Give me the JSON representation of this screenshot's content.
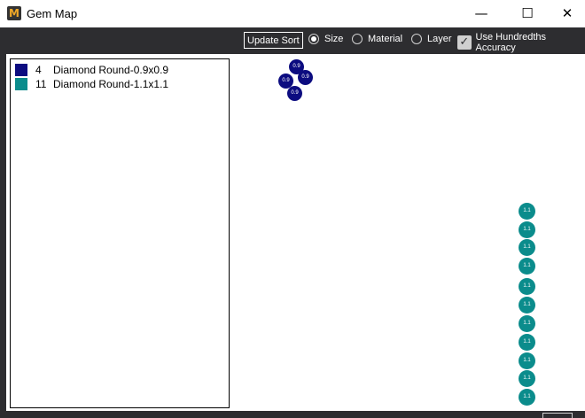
{
  "window": {
    "title": "Gem Map",
    "app_icon_letter": "M",
    "minimize_glyph": "—",
    "maximize_glyph": "☐",
    "close_glyph": "✕"
  },
  "toolbar": {
    "update_sort_label": "Update Sort",
    "radios": [
      {
        "label": "Size",
        "selected": true
      },
      {
        "label": "Material",
        "selected": false
      },
      {
        "label": "Layer",
        "selected": false
      }
    ],
    "hundredths": {
      "label": "Use Hundredths Accuracy",
      "checked": true
    }
  },
  "legend": {
    "items": [
      {
        "count": "4",
        "label": "Diamond Round-0.9x0.9",
        "color": "#0c0c80"
      },
      {
        "count": "11",
        "label": "Diamond Round-1.1x1.1",
        "color": "#0b8c8c"
      }
    ]
  },
  "gems": {
    "group_a": {
      "label": "0.9",
      "color": "#0c0c80",
      "count": 4
    },
    "group_b": {
      "label": "1.1",
      "color": "#0b8c8c",
      "count": 11
    }
  }
}
